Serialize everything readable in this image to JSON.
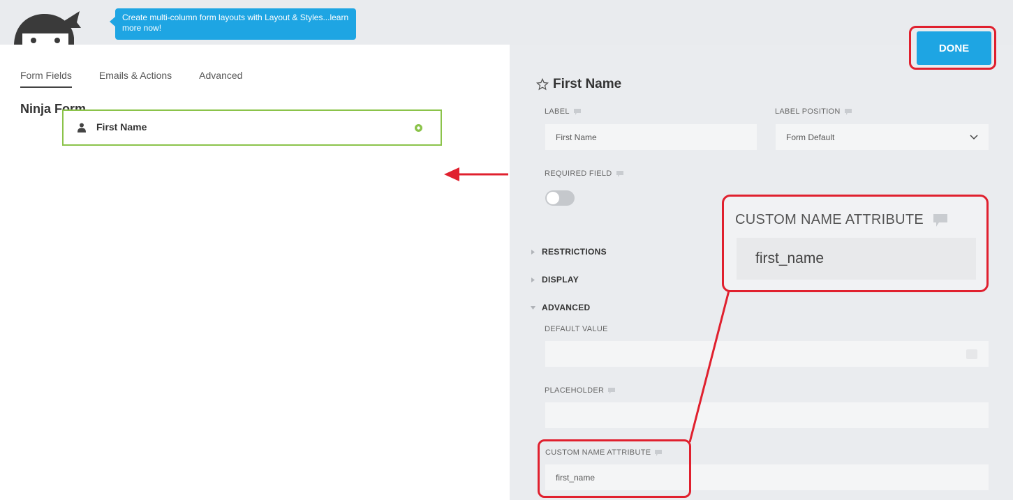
{
  "tooltip": "Create multi-column form layouts with Layout & Styles...learn more now!",
  "tabs": [
    "Form Fields",
    "Emails & Actions",
    "Advanced"
  ],
  "form_title": "Ninja Form",
  "field": {
    "label": "First Name",
    "icon": "person-icon",
    "action_icon": "gear-icon"
  },
  "done_label": "DONE",
  "settings": {
    "title": "First Name",
    "label_label": "LABEL",
    "label_value": "First Name",
    "label_position_label": "LABEL POSITION",
    "label_position_value": "Form Default",
    "required_label": "REQUIRED FIELD",
    "required_on": false,
    "sections": [
      "RESTRICTIONS",
      "DISPLAY",
      "ADVANCED"
    ],
    "default_value_label": "DEFAULT VALUE",
    "default_value": "",
    "placeholder_label": "PLACEHOLDER",
    "placeholder_value": "",
    "custom_name_label": "CUSTOM NAME ATTRIBUTE",
    "custom_name_value": "first_name"
  },
  "callout": {
    "label": "CUSTOM NAME ATTRIBUTE",
    "value": "first_name"
  },
  "colors": {
    "accent": "#1ea5e3",
    "highlight": "#e0202e",
    "field_border": "#8bc34a"
  }
}
